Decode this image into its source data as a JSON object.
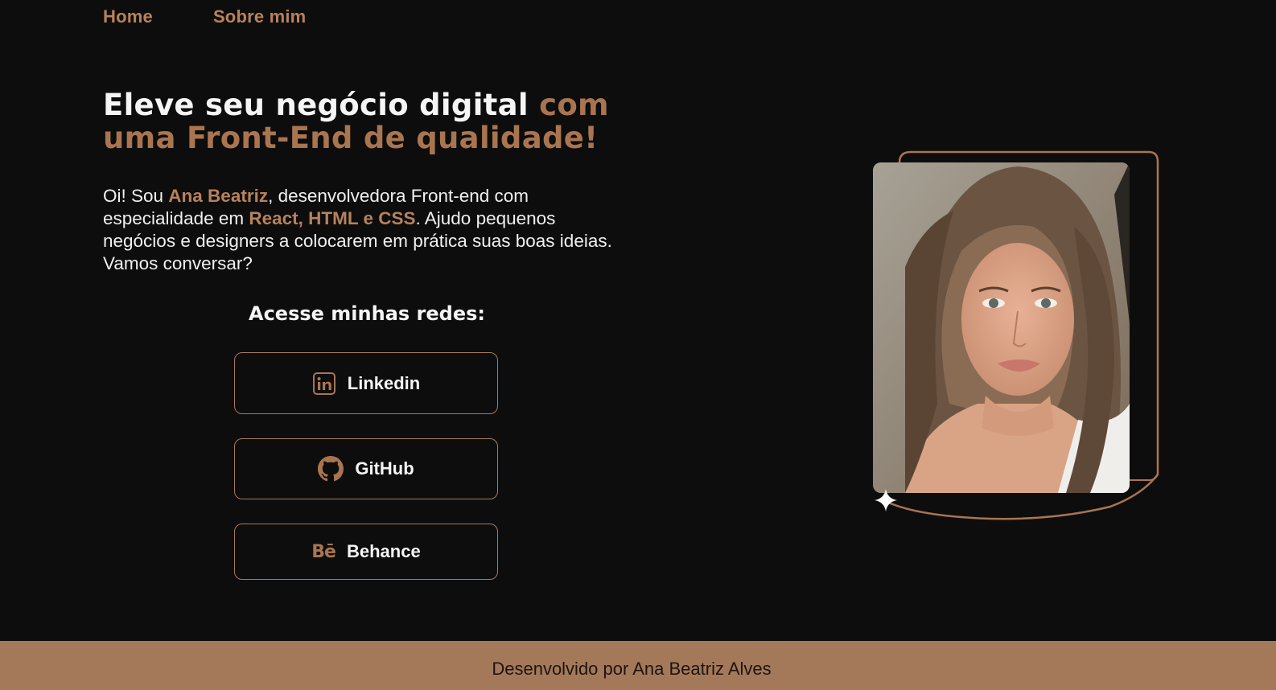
{
  "nav": {
    "home": "Home",
    "about": "Sobre mim"
  },
  "hero": {
    "headline_white": "Eleve seu negócio digital ",
    "headline_accent_1": "com",
    "headline_accent_2": "uma Front-End de qualidade!",
    "intro_1": "Oi! Sou ",
    "intro_name": "Ana Beatriz",
    "intro_2": ", desenvolvedora Front-end com especialidade em ",
    "intro_skills": "React, HTML e CSS",
    "intro_3": ". Ajudo pequenos negócios e designers a colocarem em prática suas boas ideias. Vamos conversar?"
  },
  "social": {
    "title": "Acesse minhas redes:",
    "linkedin_label": "Linkedin",
    "github_label": "GitHub",
    "behance_label": "Behance",
    "behance_glyph": "Bē"
  },
  "icons": {
    "linkedin": "linkedin-icon",
    "github": "github-icon",
    "behance": "behance-icon",
    "sparkle": "sparkle-icon"
  },
  "colors": {
    "background": "#0d0d0d",
    "accent": "#a97550",
    "footer": "#a3795a"
  },
  "footer": {
    "credit": "Desenvolvido por Ana Beatriz Alves"
  }
}
